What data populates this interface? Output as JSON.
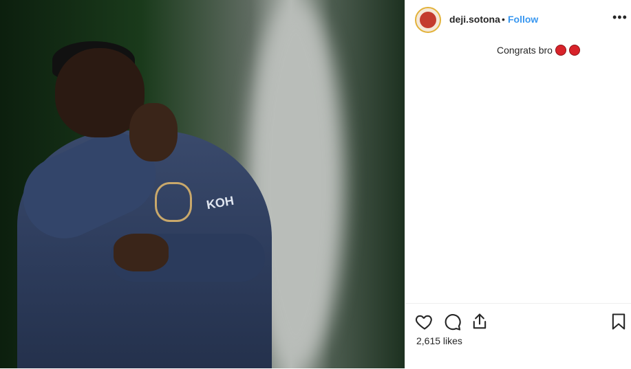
{
  "post": {
    "username": "deji.sotona",
    "separator": "•",
    "follow_label": "Follow",
    "more_icon": "more-options-icon",
    "caption": "Congrats bro",
    "caption_emojis": [
      "red-circle",
      "red-circle"
    ],
    "likes": "2,615 likes"
  },
  "photo": {
    "sponsor_text": "KOH"
  },
  "colors": {
    "follow_blue": "#3897f0",
    "text": "#262626",
    "emoji_red": "#d8232a"
  }
}
